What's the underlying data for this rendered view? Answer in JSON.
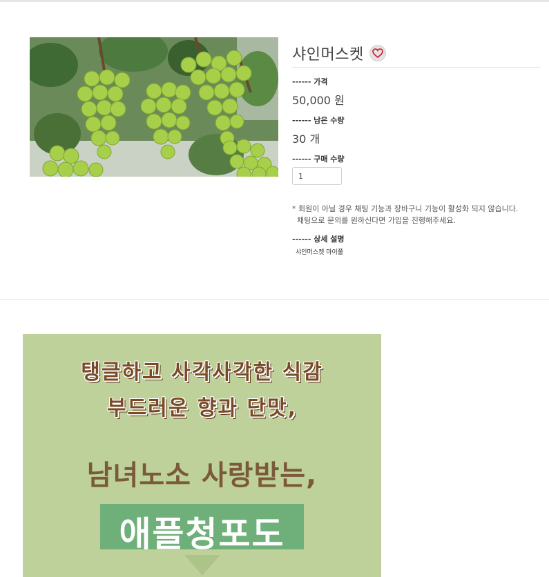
{
  "product": {
    "name": "샤인머스켓",
    "price_label": "------ 가격",
    "price_value": "50,000 원",
    "stock_label": "------ 남은 수량",
    "stock_value": "30 개",
    "qty_label": "------ 구매 수량",
    "qty_value": "1",
    "notice_line1": "* 회원이 아닐 경우 채팅 기능과 장바구니 기능이 활성화 되지 않습니다.",
    "notice_line2": "채팅으로 문의를 원하신다면 가입을 진행해주세요.",
    "detail_label": "------ 상세 설명",
    "detail_text": "샤인머스켓 마이쭐"
  },
  "icons": {
    "wishlist": "heart-icon"
  },
  "banner": {
    "line1": "탱글하고 사각사각한 식감",
    "line2": "부드러운 향과 단맛,",
    "line3": "남녀노소 사랑받는,",
    "line4": "애플청포도"
  },
  "colors": {
    "banner_bg": "#bfd19a",
    "banner_highlight": "#6fb07a",
    "heart": "#d0243a",
    "headline_brown": "#7a4a26"
  }
}
